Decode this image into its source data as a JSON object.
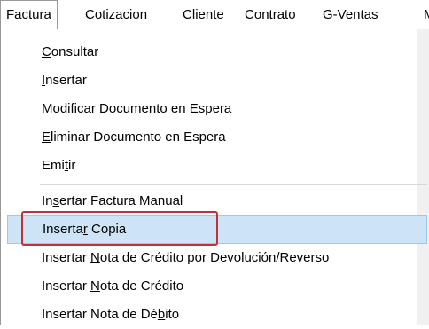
{
  "menubar": {
    "items": [
      {
        "pre": "",
        "key": "F",
        "post": "actura"
      },
      {
        "pre": "",
        "key": "C",
        "post": "otizacion"
      },
      {
        "pre": "C",
        "key": "l",
        "post": "iente"
      },
      {
        "pre": "C",
        "key": "o",
        "post": "ntrato"
      },
      {
        "pre": "",
        "key": "G",
        "post": "-Ventas"
      },
      {
        "pre": "",
        "key": "M",
        "post": ""
      }
    ]
  },
  "dropdown": {
    "items": [
      {
        "pre": "",
        "key": "C",
        "post": "onsultar"
      },
      {
        "pre": "",
        "key": "I",
        "post": "nsertar"
      },
      {
        "pre": "",
        "key": "M",
        "post": "odificar Documento en Espera"
      },
      {
        "pre": "",
        "key": "E",
        "post": "liminar Documento en Espera"
      },
      {
        "pre": "Emi",
        "key": "t",
        "post": "ir"
      },
      {
        "pre": "In",
        "key": "s",
        "post": "ertar Factura Manual"
      },
      {
        "pre": "Inserta",
        "key": "r",
        "post": " Copia"
      },
      {
        "pre": "Insertar ",
        "key": "N",
        "post": "ota de Crédito por Devolución/Reverso"
      },
      {
        "pre": "Insertar ",
        "key": "N",
        "post": "ota de Crédito"
      },
      {
        "pre": "Insertar Nota de Dé",
        "key": "b",
        "post": "ito"
      }
    ],
    "highlighted_index": 6
  },
  "colors": {
    "highlight_bg": "#cde4f7",
    "highlight_border": "#99c9ef",
    "callout": "#c0323a"
  }
}
